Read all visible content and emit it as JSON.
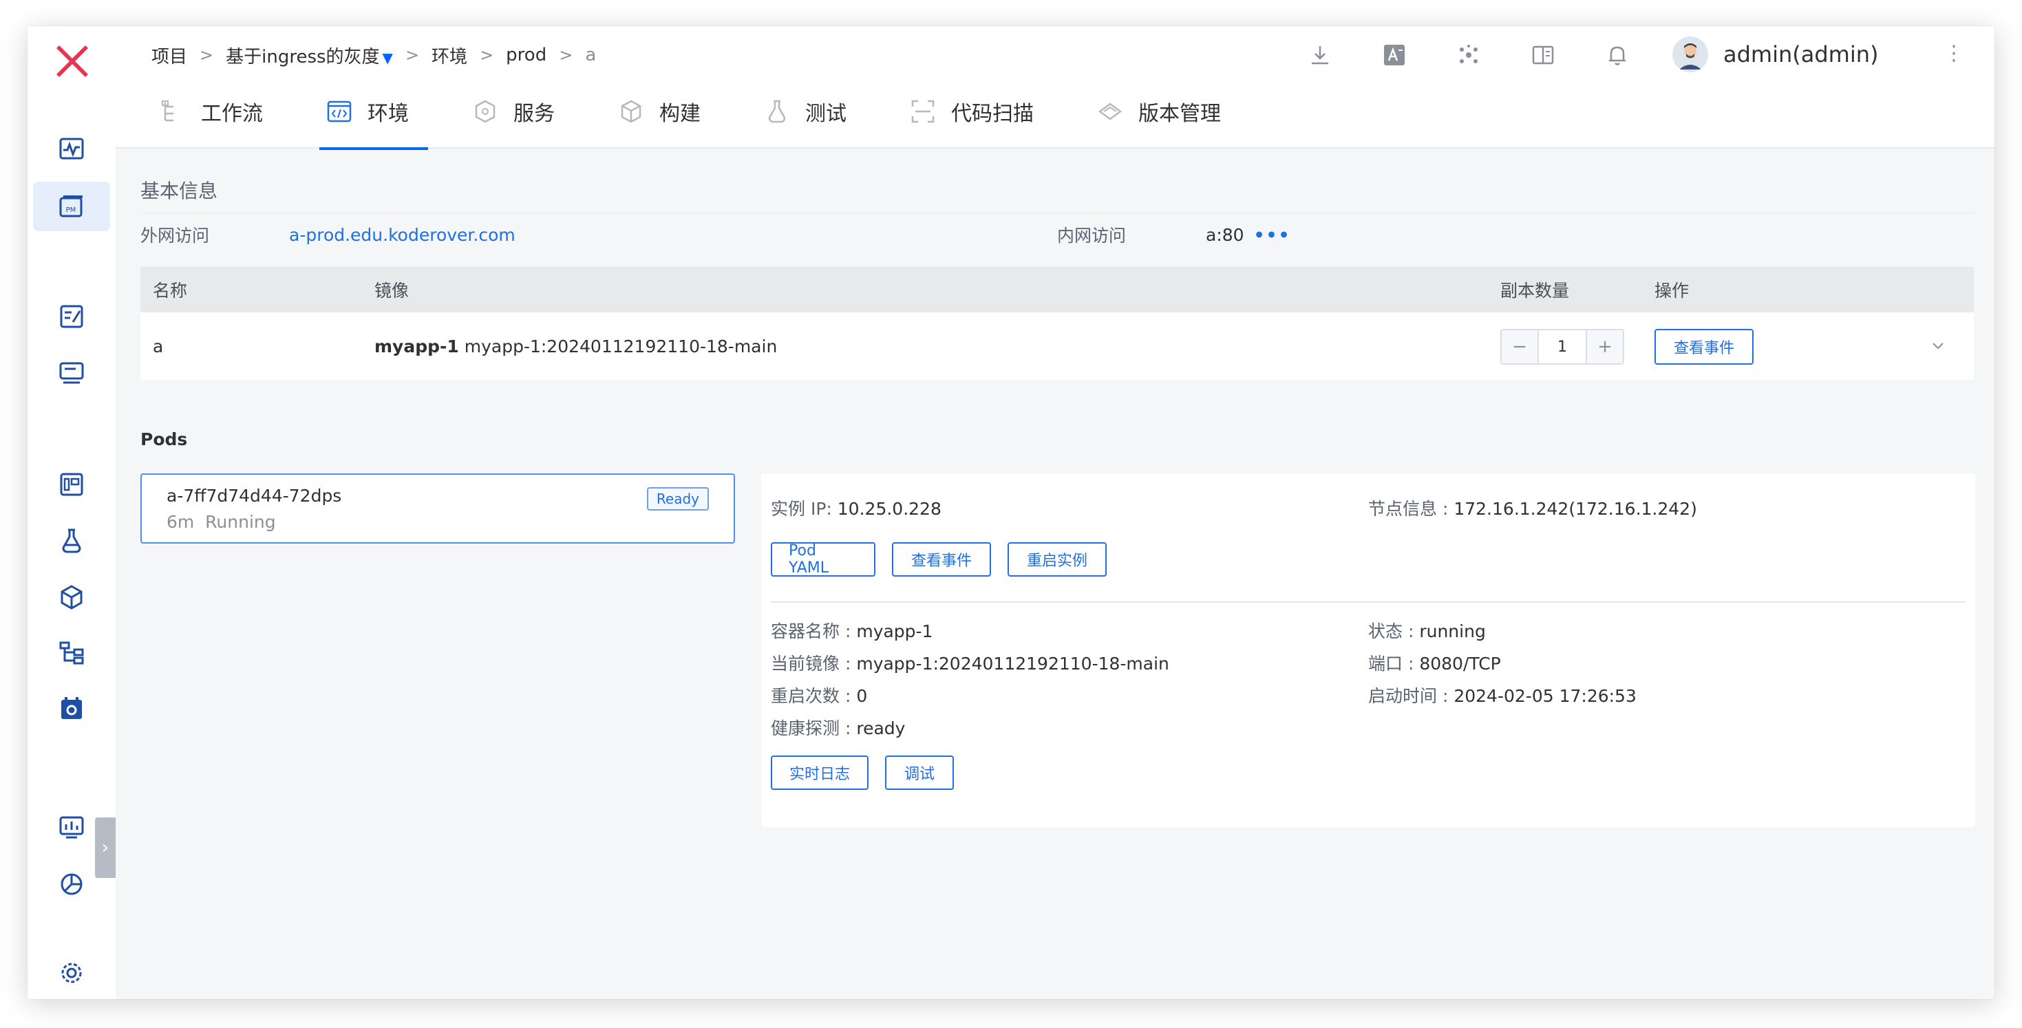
{
  "rail": {
    "icons": [
      "logo-x-icon",
      "activity-chart-icon",
      "project-manage-icon",
      "edit-note-icon",
      "deploy-icon",
      "dashboard-icon",
      "test-flask-icon",
      "build-box-icon",
      "workflow-tree-icon",
      "settings-calendar-icon",
      "monitor-chart-icon",
      "pie-chart-icon",
      "gear-icon"
    ],
    "active": "project-manage-icon",
    "pm_text": "PM",
    "collapse": "›"
  },
  "breadcrumb": {
    "items": [
      "项目",
      "基于ingress的灰度",
      "环境",
      "prod",
      "a"
    ],
    "separator": ">",
    "caret": "▼"
  },
  "header": {
    "user_name": "admin(admin)",
    "more": "⋮",
    "icons": [
      "download-icon",
      "translate-icon",
      "cluster-icon",
      "book-icon",
      "bell-icon"
    ]
  },
  "tabs": [
    {
      "label": "工作流",
      "icon": "workflow-icon",
      "active": false
    },
    {
      "label": "环境",
      "icon": "code-window-icon",
      "active": true
    },
    {
      "label": "服务",
      "icon": "service-cube-icon",
      "active": false
    },
    {
      "label": "构建",
      "icon": "build-box-icon",
      "active": false
    },
    {
      "label": "测试",
      "icon": "flask-icon",
      "active": false
    },
    {
      "label": "代码扫描",
      "icon": "scan-icon",
      "active": false
    },
    {
      "label": "版本管理",
      "icon": "version-icon",
      "active": false
    }
  ],
  "basic": {
    "title": "基本信息",
    "external_label": "外网访问",
    "external_value": "a-prod.edu.koderover.com",
    "internal_label": "内网访问",
    "internal_value": "a:80",
    "internal_more": "•••"
  },
  "service_table": {
    "columns": [
      "名称",
      "镜像",
      "副本数量",
      "操作"
    ],
    "row": {
      "name": "a",
      "image_container": "myapp-1",
      "image_tag": "myapp-1:20240112192110-18-main",
      "replicas": "1",
      "minus": "−",
      "plus": "+",
      "action": "查看事件"
    }
  },
  "pods": {
    "title": "Pods",
    "card": {
      "name": "a-7ff7d74d44-72dps",
      "age": "6m",
      "phase": "Running",
      "badge": "Ready"
    },
    "detail": {
      "ip_label": "实例 IP",
      "ip_value": "10.25.0.228",
      "node_label": "节点信息",
      "node_value": "172.16.1.242(172.16.1.242)",
      "buttons": [
        "Pod YAML",
        "查看事件",
        "重启实例"
      ],
      "container_name_label": "容器名称",
      "container_name_value": "myapp-1",
      "status_label": "状态",
      "status_value": "running",
      "current_image_label": "当前镜像",
      "current_image_value": "myapp-1:20240112192110-18-main",
      "port_label": "端口",
      "port_value": "8080/TCP",
      "restart_label": "重启次数",
      "restart_value": "0",
      "start_label": "启动时间",
      "start_value": "2024-02-05 17:26:53",
      "health_label": "健康探测",
      "health_value": "ready",
      "container_buttons": [
        "实时日志",
        "调试"
      ]
    }
  },
  "colors": {
    "accent": "#0066ff",
    "link": "#1f6fe6",
    "logo": "#e8344e",
    "rail_icon": "#1e4fa3"
  }
}
